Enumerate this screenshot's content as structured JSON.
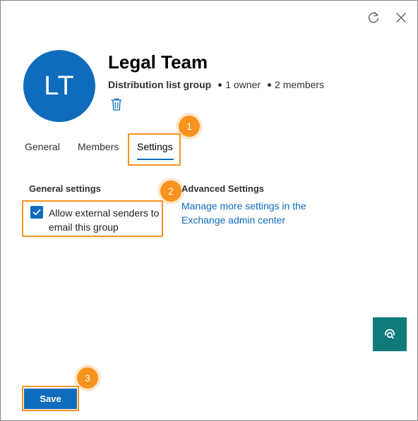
{
  "header": {
    "refresh_icon": "refresh-icon",
    "close_icon": "close-icon"
  },
  "group": {
    "initials": "LT",
    "name": "Legal Team",
    "type": "Distribution list group",
    "owners": "1 owner",
    "members": "2 members",
    "delete_icon": "trash-icon",
    "avatar_color": "#0f6cbd"
  },
  "tabs": [
    {
      "label": "General",
      "active": false
    },
    {
      "label": "Members",
      "active": false
    },
    {
      "label": "Settings",
      "active": true
    }
  ],
  "general_settings": {
    "heading": "General settings",
    "allow_external": {
      "label": "Allow external senders to email this group",
      "checked": true
    }
  },
  "advanced_settings": {
    "heading": "Advanced Settings",
    "link": "Manage more settings in the Exchange admin center"
  },
  "footer": {
    "save_label": "Save"
  },
  "help_icon": "headset-icon",
  "callouts": [
    {
      "number": "1"
    },
    {
      "number": "2"
    },
    {
      "number": "3"
    }
  ],
  "colors": {
    "accent": "#0f6cbd",
    "callout": "#f7931e",
    "help_button": "#0e7a7a"
  }
}
